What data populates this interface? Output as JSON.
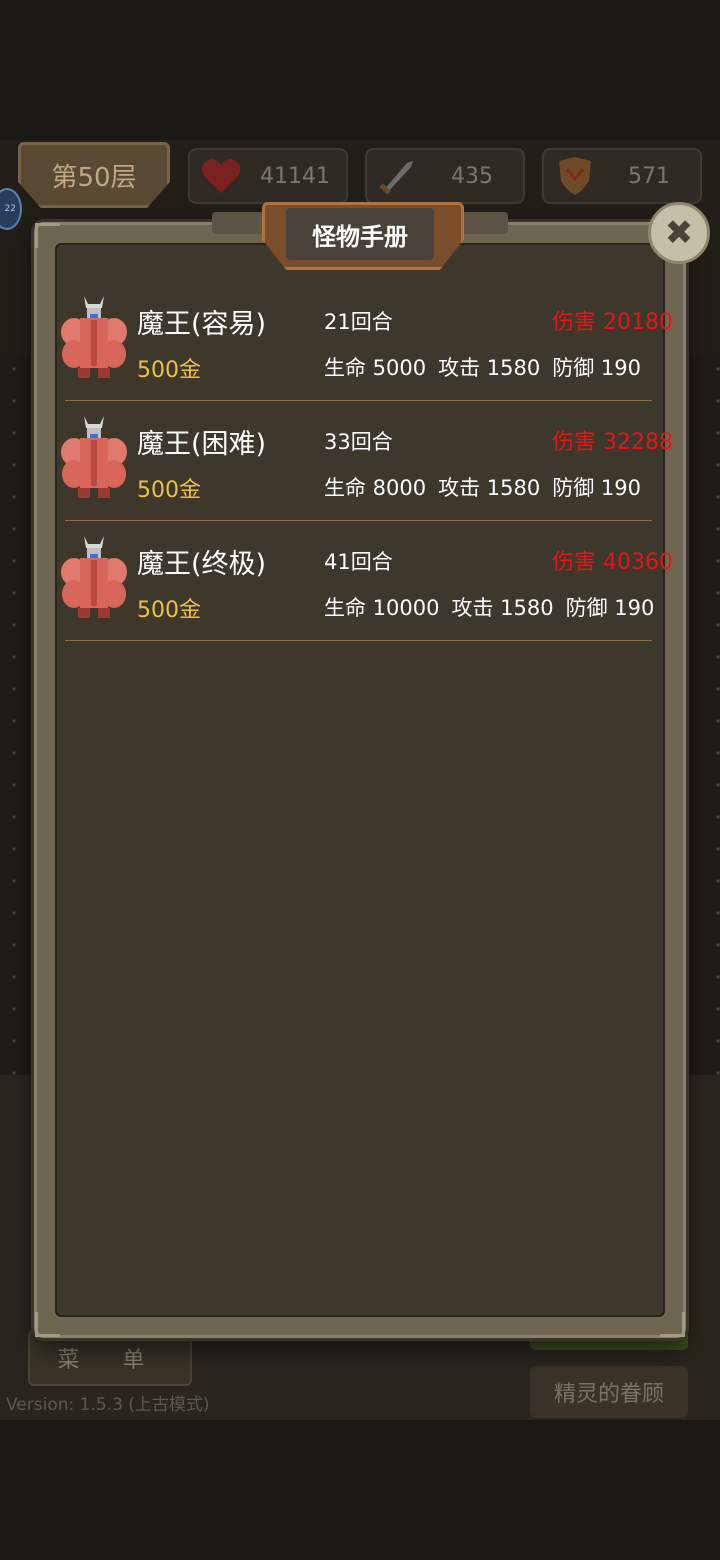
{
  "hud": {
    "floor": "第50层",
    "hp": "41141",
    "attack": "435",
    "defense": "571",
    "level_badge": "22",
    "menu_label": "菜 单",
    "version": "Version: 1.5.3 (上古模式)",
    "blessing_label": "精灵的眷顾"
  },
  "modal": {
    "title": "怪物手册",
    "close_icon": "close-x-icon"
  },
  "monsters": [
    {
      "name": "魔王(容易)",
      "turns": "21回合",
      "damage": "伤害 20180",
      "gold": "500金",
      "hp": "生命 5000",
      "atk": "攻击 1580",
      "def": "防御 190"
    },
    {
      "name": "魔王(困难)",
      "turns": "33回合",
      "damage": "伤害 32288",
      "gold": "500金",
      "hp": "生命 8000",
      "atk": "攻击 1580",
      "def": "防御 190"
    },
    {
      "name": "魔王(终极)",
      "turns": "41回合",
      "damage": "伤害 40360",
      "gold": "500金",
      "hp": "生命 10000",
      "atk": "攻击 1580",
      "def": "防御 190"
    }
  ],
  "colors": {
    "damage": "#e21717",
    "gold": "#f1c043"
  }
}
